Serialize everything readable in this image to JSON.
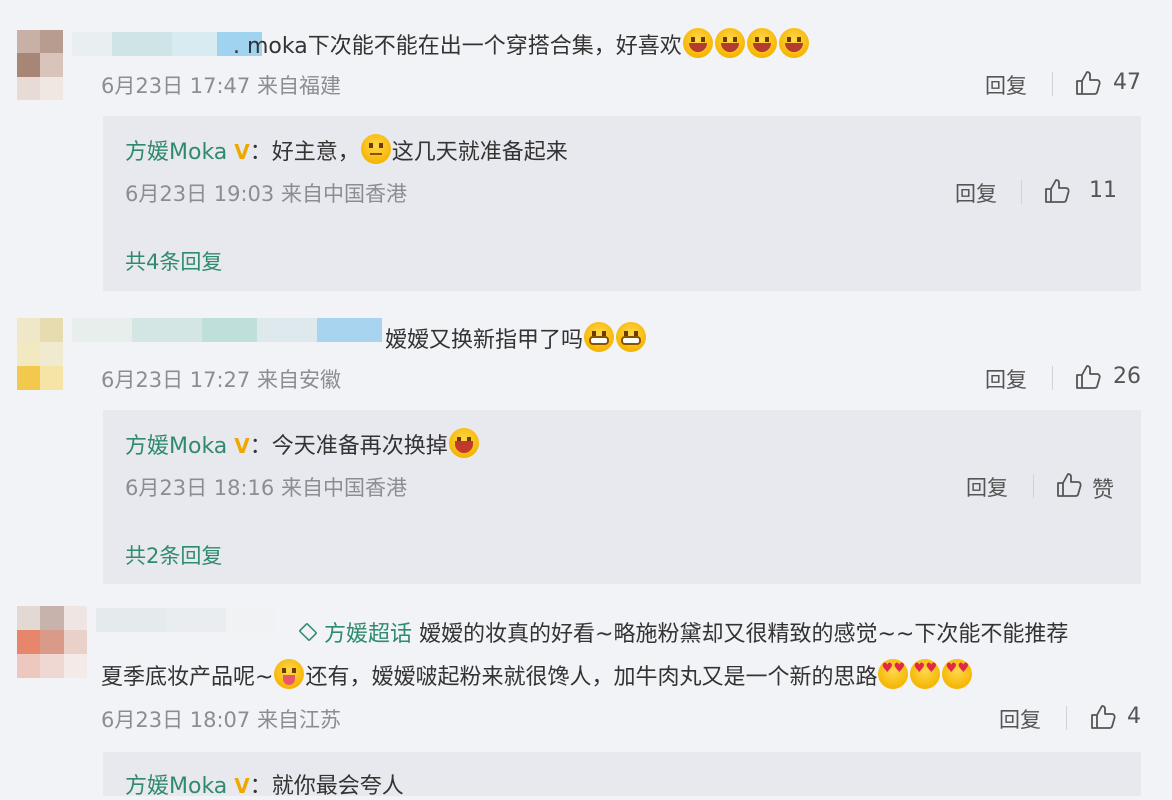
{
  "icons": {
    "like": "thumbs-up-icon",
    "verified": "verified-v-badge",
    "topic": "super-topic-icon"
  },
  "colors": {
    "name": "#2f8a6e",
    "verified": "#f0a800",
    "meta": "#8b8d93",
    "background": "#f2f3f7",
    "reply_bg": "#e8e9ee"
  },
  "comments": [
    {
      "dot": ".",
      "text": "moka下次能不能在出一个穿搭合集，好喜欢",
      "date": "6月23日 17:47 来自福建",
      "reply_label": "回复",
      "likes": "47",
      "reply": {
        "name": "方媛Moka",
        "v": "V",
        "text_a": "：好主意，",
        "text_b": "这几天就准备起来",
        "date": "6月23日 19:03 来自中国香港",
        "reply_label": "回复",
        "likes": "11"
      },
      "more": "共4条回复"
    },
    {
      "text": "嫒嫒又换新指甲了吗",
      "date": "6月23日 17:27 来自安徽",
      "reply_label": "回复",
      "likes": "26",
      "reply": {
        "name": "方媛Moka",
        "v": "V",
        "text_a": "：今天准备再次换掉",
        "date": "6月23日 18:16 来自中国香港",
        "reply_label": "回复",
        "likes": "赞"
      },
      "more": "共2条回复"
    },
    {
      "topic": "方媛超话",
      "text_line1": "嫒嫒的妆真的好看~略施粉黛却又很精致的感觉~~下次能不能推荐",
      "text_line2a": "夏季底妆产品呢~",
      "text_line2b": "还有，嫒嫒啵起粉来就很馋人，加牛肉丸又是一个新的思路",
      "date": "6月23日 18:07 来自江苏",
      "reply_label": "回复",
      "likes": "4",
      "reply": {
        "name": "方媛Moka",
        "v": "V",
        "text_a": "：就你最会夸人"
      }
    }
  ]
}
